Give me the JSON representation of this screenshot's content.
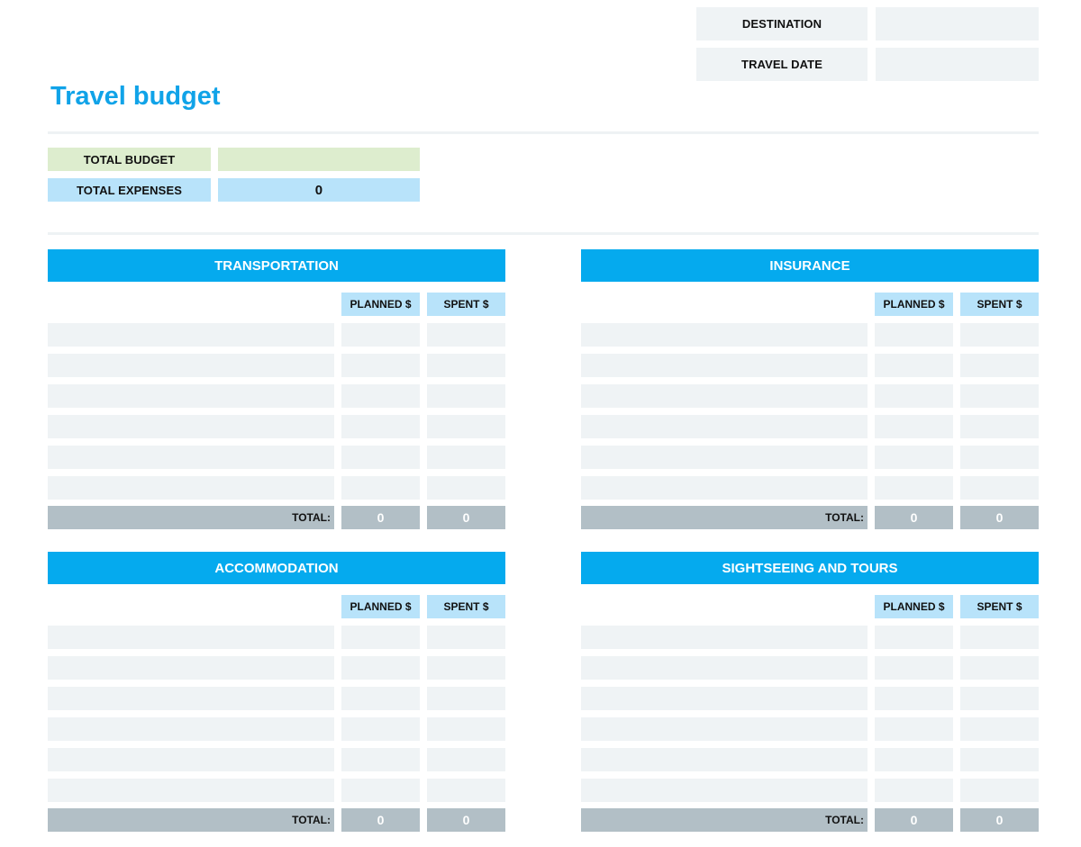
{
  "header": {
    "title": "Travel budget",
    "destination_label": "DESTINATION",
    "destination_value": "",
    "travel_date_label": "TRAVEL DATE",
    "travel_date_value": ""
  },
  "summary": {
    "total_budget_label": "TOTAL BUDGET",
    "total_budget_value": "",
    "total_expenses_label": "TOTAL EXPENSES",
    "total_expenses_value": "0"
  },
  "colors": {
    "accent": "#05aaee",
    "title": "#10a3e8",
    "subheader": "#b8e3fa",
    "budget_green": "#ddedce",
    "input_cell": "#eff3f5",
    "total_row": "#b2bfc6"
  },
  "sections": [
    {
      "title": "TRANSPORTATION",
      "planned_label": "PLANNED $",
      "spent_label": "SPENT $",
      "rows": [
        {
          "item": "",
          "planned": "",
          "spent": ""
        },
        {
          "item": "",
          "planned": "",
          "spent": ""
        },
        {
          "item": "",
          "planned": "",
          "spent": ""
        },
        {
          "item": "",
          "planned": "",
          "spent": ""
        },
        {
          "item": "",
          "planned": "",
          "spent": ""
        },
        {
          "item": "",
          "planned": "",
          "spent": ""
        }
      ],
      "total_label": "TOTAL:",
      "total_planned": "0",
      "total_spent": "0"
    },
    {
      "title": "INSURANCE",
      "planned_label": "PLANNED $",
      "spent_label": "SPENT $",
      "rows": [
        {
          "item": "",
          "planned": "",
          "spent": ""
        },
        {
          "item": "",
          "planned": "",
          "spent": ""
        },
        {
          "item": "",
          "planned": "",
          "spent": ""
        },
        {
          "item": "",
          "planned": "",
          "spent": ""
        },
        {
          "item": "",
          "planned": "",
          "spent": ""
        },
        {
          "item": "",
          "planned": "",
          "spent": ""
        }
      ],
      "total_label": "TOTAL:",
      "total_planned": "0",
      "total_spent": "0"
    },
    {
      "title": "ACCOMMODATION",
      "planned_label": "PLANNED $",
      "spent_label": "SPENT $",
      "rows": [
        {
          "item": "",
          "planned": "",
          "spent": ""
        },
        {
          "item": "",
          "planned": "",
          "spent": ""
        },
        {
          "item": "",
          "planned": "",
          "spent": ""
        },
        {
          "item": "",
          "planned": "",
          "spent": ""
        },
        {
          "item": "",
          "planned": "",
          "spent": ""
        },
        {
          "item": "",
          "planned": "",
          "spent": ""
        }
      ],
      "total_label": "TOTAL:",
      "total_planned": "0",
      "total_spent": "0"
    },
    {
      "title": "SIGHTSEEING AND TOURS",
      "planned_label": "PLANNED $",
      "spent_label": "SPENT $",
      "rows": [
        {
          "item": "",
          "planned": "",
          "spent": ""
        },
        {
          "item": "",
          "planned": "",
          "spent": ""
        },
        {
          "item": "",
          "planned": "",
          "spent": ""
        },
        {
          "item": "",
          "planned": "",
          "spent": ""
        },
        {
          "item": "",
          "planned": "",
          "spent": ""
        },
        {
          "item": "",
          "planned": "",
          "spent": ""
        }
      ],
      "total_label": "TOTAL:",
      "total_planned": "0",
      "total_spent": "0"
    }
  ]
}
